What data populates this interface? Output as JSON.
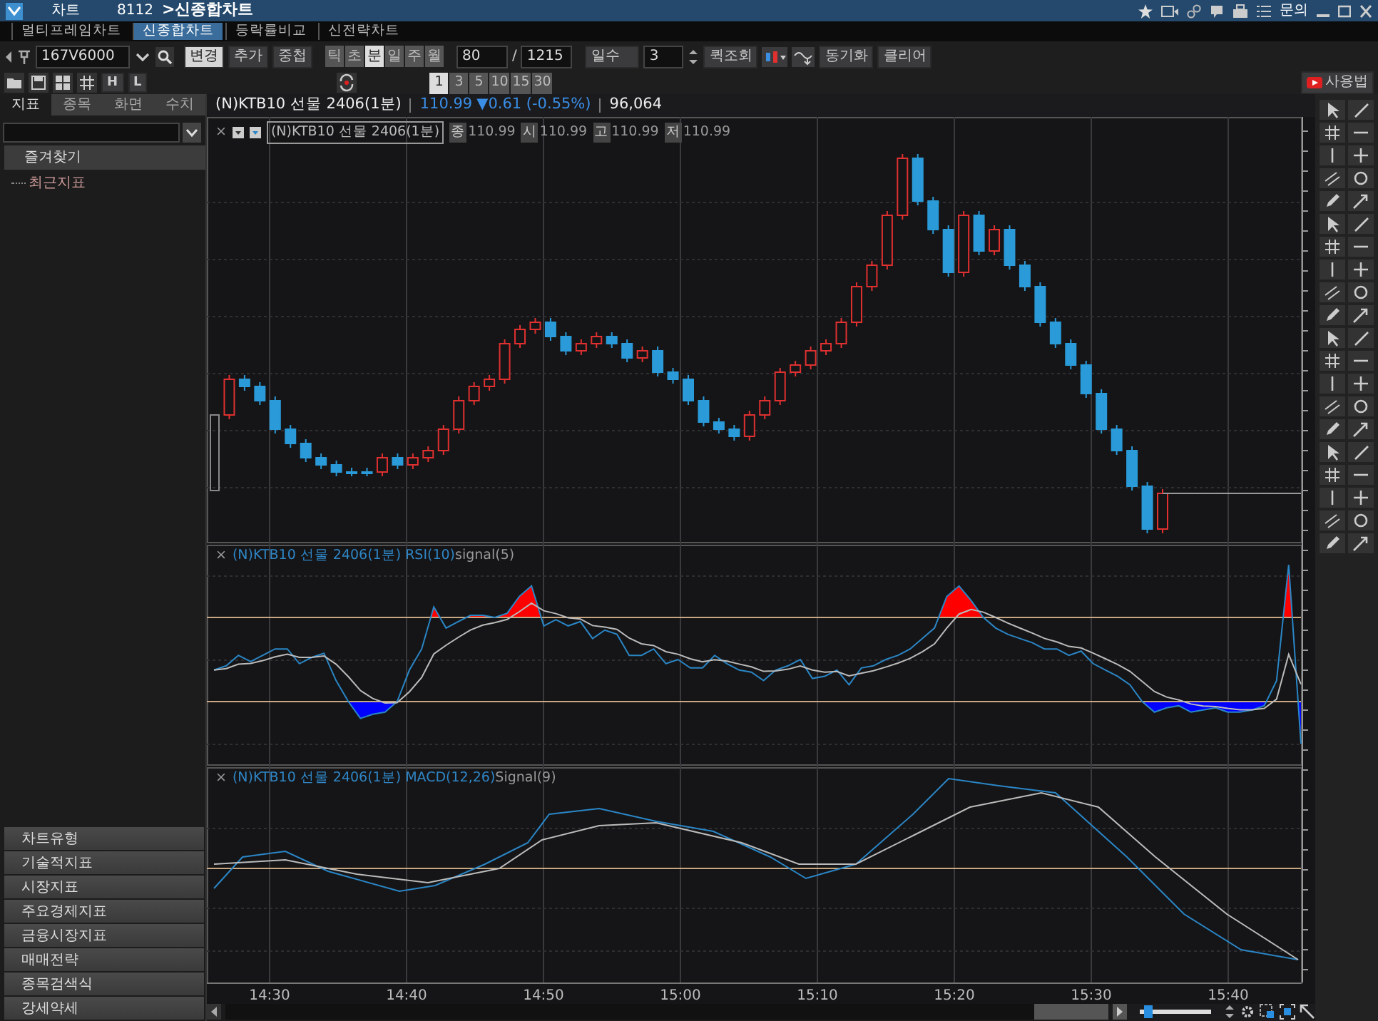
{
  "window": {
    "app_name": "차트",
    "screen_number": "8112",
    "title": ">신종합차트",
    "menu_text": "문의"
  },
  "tabs": [
    {
      "label": "멀티프레임차트",
      "selected": false
    },
    {
      "label": "신종합차트",
      "selected": true
    },
    {
      "label": "등락률비교",
      "selected": false
    },
    {
      "label": "신전략차트",
      "selected": false
    }
  ],
  "toolbar": {
    "symbol_code": "167V6000",
    "buttons": [
      "변경",
      "추가",
      "중첩"
    ],
    "periods": [
      {
        "label": "틱",
        "selected": false
      },
      {
        "label": "초",
        "selected": false
      },
      {
        "label": "분",
        "selected": true
      },
      {
        "label": "일",
        "selected": false
      },
      {
        "label": "주",
        "selected": false
      },
      {
        "label": "월",
        "selected": false
      }
    ],
    "count": "80",
    "separator": "/",
    "total": "1215",
    "range_unit": "일수",
    "range_value": "3",
    "actions": [
      "퀵조회",
      "동기화",
      "클리어"
    ]
  },
  "toolbar2": {
    "hl_buttons": [
      "H",
      "L"
    ],
    "intervals": [
      {
        "label": "1",
        "selected": true
      },
      {
        "label": "3",
        "selected": false
      },
      {
        "label": "5",
        "selected": false
      },
      {
        "label": "10",
        "selected": false
      },
      {
        "label": "15",
        "selected": false
      },
      {
        "label": "30",
        "selected": false
      }
    ],
    "help_button": "사용법"
  },
  "left_panel": {
    "tabs": [
      {
        "label": "지표",
        "selected": true
      },
      {
        "label": "종목",
        "selected": false
      },
      {
        "label": "화면",
        "selected": false
      },
      {
        "label": "수치",
        "selected": false
      }
    ],
    "favorites_header": "즐겨찾기",
    "tree": [
      {
        "label": "최근지표"
      }
    ],
    "categories": [
      "차트유형",
      "기술적지표",
      "시장지표",
      "주요경제지표",
      "금융시장지표",
      "매매전략",
      "종목검색식",
      "강세약세"
    ]
  },
  "chart": {
    "header": {
      "name": "(N)KTB10 선물 2406(1분)",
      "price": "110.99",
      "change": "▼0.61 (-0.55%)",
      "volume": "96,064"
    },
    "price_panel": {
      "close_mark": "×",
      "legend": "(N)KTB10 선물 2406(1분)",
      "ohlc": [
        {
          "label": "종",
          "value": "110.99"
        },
        {
          "label": "시",
          "value": "110.99"
        },
        {
          "label": "고",
          "value": "110.99"
        },
        {
          "label": "저",
          "value": "110.99"
        }
      ]
    },
    "rsi_panel": {
      "close_mark": "×",
      "legend": "(N)KTB10 선물 2406(1분) RSI(10)",
      "signal": "signal(5)"
    },
    "macd_panel": {
      "close_mark": "×",
      "legend": "(N)KTB10 선물 2406(1분) MACD(12,26)",
      "signal": "Signal(9)"
    },
    "time_labels": [
      "14:30",
      "14:40",
      "14:50",
      "15:00",
      "15:10",
      "15:20",
      "15:30",
      "15:40"
    ],
    "zoom_slider": {
      "level": 0.06
    }
  }
}
